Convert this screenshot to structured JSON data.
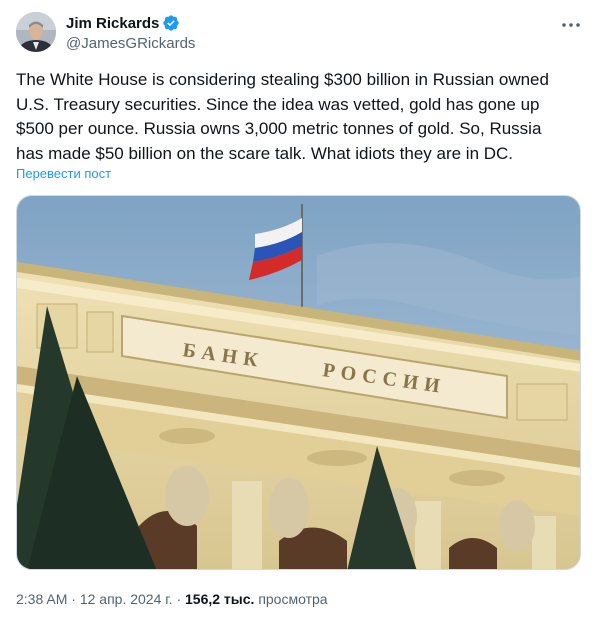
{
  "tweet": {
    "author": {
      "display_name": "Jim Rickards",
      "handle": "@JamesGRickards",
      "verified": true
    },
    "text_lines": [
      "The White House is considering stealing $300 billion in Russian owned",
      "U.S. Treasury securities. Since the idea was vetted, gold has gone up",
      "$500 per ounce. Russia owns 3,000 metric tonnes of gold. So, Russia",
      "has made $50 billion on the scare talk. What idiots they are in DC."
    ],
    "translate_label": "Перевести пост",
    "image": {
      "sign_text_left": "БАНК",
      "sign_text_right": "РОССИИ"
    },
    "time": "2:38 AM",
    "separator": "·",
    "date": "12 апр. 2024 г.",
    "views_count": "156,2 тыс.",
    "views_label": "просмотра"
  },
  "colors": {
    "verified_badge": "#1d9bf0",
    "link": "#1d9bf0",
    "secondary_text": "#536471"
  },
  "icons": {
    "more": "more-dots-icon",
    "verified": "verified-badge-icon"
  }
}
